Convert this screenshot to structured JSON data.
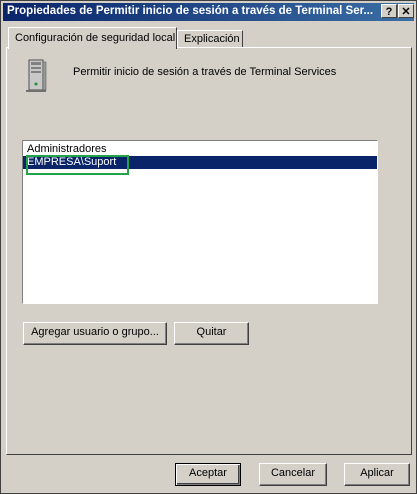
{
  "window": {
    "title": "Propiedades de Permitir inicio de sesión a través de Terminal Ser...",
    "help_button": "?",
    "close_button": "✕"
  },
  "tabs": [
    {
      "label": "Configuración de seguridad local",
      "active": true
    },
    {
      "label": "Explicación",
      "active": false
    }
  ],
  "policy": {
    "name": "Permitir inicio de sesión a través de Terminal Services",
    "icon": "server-icon"
  },
  "members": {
    "items": [
      {
        "label": "Administradores",
        "selected": false
      },
      {
        "label": "EMPRESA\\Suport",
        "selected": true
      }
    ],
    "highlight_color": "#22a34a"
  },
  "actions": {
    "add": "Agregar usuario o grupo...",
    "remove": "Quitar"
  },
  "footer": {
    "ok": "Aceptar",
    "cancel": "Cancelar",
    "apply": "Aplicar"
  }
}
